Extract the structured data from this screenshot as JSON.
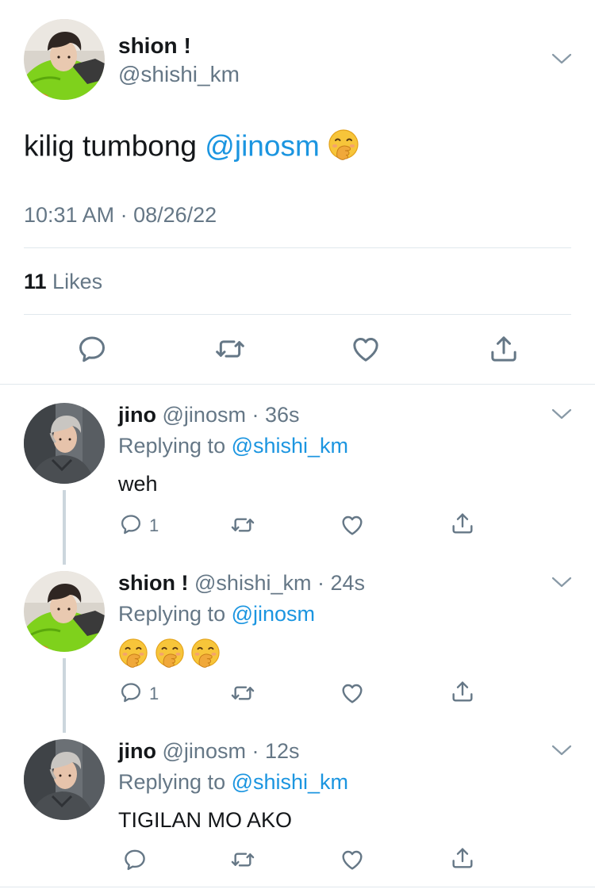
{
  "main_tweet": {
    "name": "shion !",
    "handle": "@shishi_km",
    "text": "kilig tumbong ",
    "mention": "@jinosm",
    "emoji": "hand-over-mouth-emoji",
    "timestamp": "10:31 AM · 08/26/22",
    "likes_count": "11",
    "likes_label": " Likes"
  },
  "replies": [
    {
      "name": "jino",
      "handle": "@jinosm",
      "time": " · 36s",
      "replying_label": "Replying to ",
      "replying_to": "@shishi_km",
      "text": "weh",
      "reply_count": "1"
    },
    {
      "name": "shion !",
      "handle": "@shishi_km",
      "time": " · 24s",
      "replying_label": "Replying to ",
      "replying_to": "@jinosm",
      "emojis": [
        "hand-over-mouth-emoji",
        "hand-over-mouth-emoji",
        "hand-over-mouth-emoji"
      ],
      "reply_count": "1"
    },
    {
      "name": "jino",
      "handle": "@jinosm",
      "time": " · 12s",
      "replying_label": "Replying to ",
      "replying_to": "@shishi_km",
      "text": "TIGILAN MO AKO"
    }
  ],
  "icons": {
    "reply": "reply-icon",
    "retweet": "retweet-icon",
    "like": "heart-icon",
    "share": "share-icon",
    "chevron": "chevron-down-icon"
  },
  "colors": {
    "text": "#14171a",
    "secondary": "#657786",
    "link": "#1b95e0",
    "divider": "#e1e8ed",
    "thread_line": "#ccd6dd"
  }
}
